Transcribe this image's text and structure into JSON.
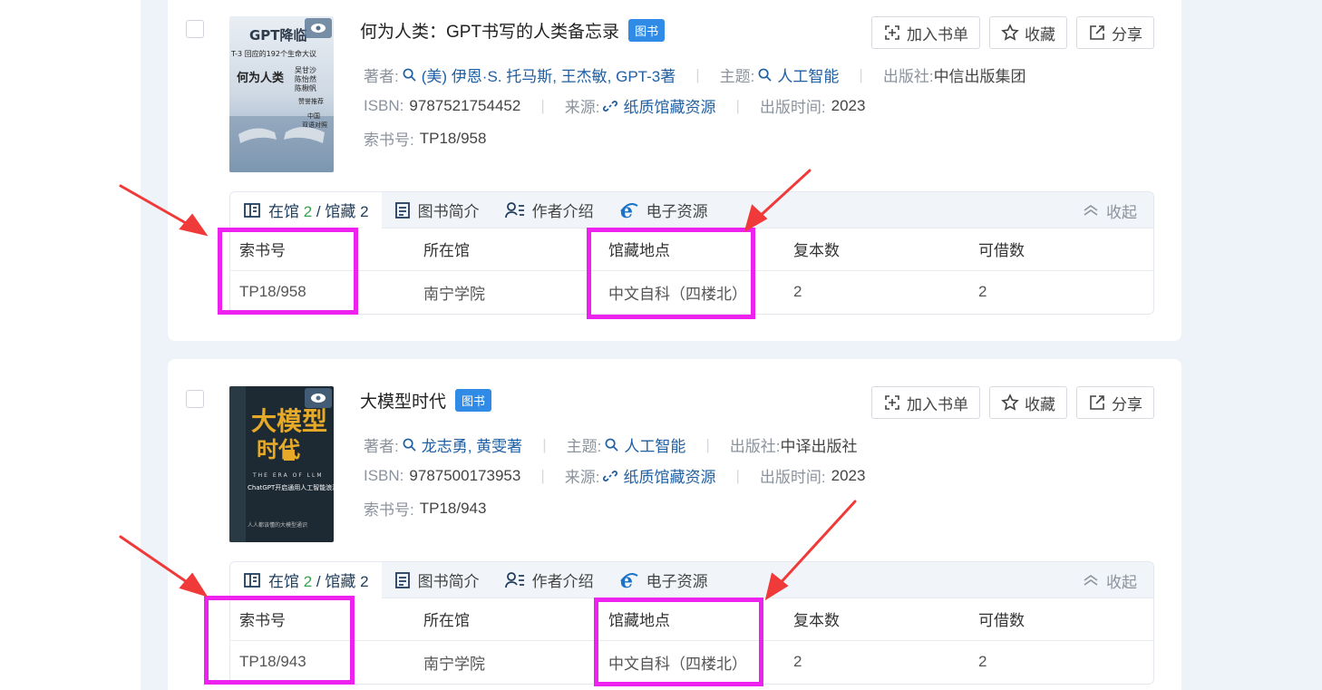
{
  "tables": {
    "headers": [
      "索书号",
      "所在馆",
      "馆藏地点",
      "复本数",
      "可借数"
    ]
  },
  "labels": {
    "author": "著者:",
    "subject": "主题:",
    "publisher": "出版社:",
    "isbn": "ISBN:",
    "source": "来源:",
    "pubyear": "出版时间:",
    "callno": "索书号:",
    "tab_avail_prefix": "在馆",
    "tab_avail_mid": " / 馆藏",
    "tab_intro": "图书简介",
    "tab_author": "作者介绍",
    "tab_eres": "电子资源",
    "collapse": "收起",
    "add_list": "加入书单",
    "favorite": "收藏",
    "share": "分享"
  },
  "colors": {
    "highlight": "#ee22ee",
    "arrow": "#f03a3a",
    "link": "#1f5fa3",
    "badge": "#2f8be6"
  },
  "books": [
    {
      "title": "何为人类：GPT书写的人类备忘录",
      "type": "图书",
      "author": "(美) 伊恩·S. 托马斯, 王杰敏, GPT-3著",
      "subject": "人工智能",
      "publisher": "中信出版集团",
      "isbn": "9787521754452",
      "source": "纸质馆藏资源",
      "pubyear": "2023",
      "callno": "TP18/958",
      "avail": "2",
      "held": "2",
      "row": [
        "TP18/958",
        "南宁学院",
        "中文自科（四楼北）",
        "2",
        "2"
      ],
      "cover_text": "GPT降临",
      "cover_sub1": "T-3 回应的192个生命大议",
      "cover_sub2": "何为人类",
      "cover_names": [
        "吴甘沙",
        "陈怡然",
        "陈楸帆"
      ],
      "cover_tag": "赞誉推荐",
      "cover_side": [
        "中国",
        "双语对照"
      ]
    },
    {
      "title": "大模型时代",
      "type": "图书",
      "author": "龙志勇, 黄雯著",
      "subject": "人工智能",
      "publisher": "中译出版社",
      "isbn": "9787500173953",
      "source": "纸质馆藏资源",
      "pubyear": "2023",
      "callno": "TP18/943",
      "avail": "2",
      "held": "2",
      "row": [
        "TP18/943",
        "南宁学院",
        "中文自科（四楼北）",
        "2",
        "2"
      ],
      "cover_text": "大模型",
      "cover_text2": "时代",
      "cover_en": "THE ERA OF LLM",
      "cover_sub1": "ChatGPT开启通用人工智能浪潮",
      "cover_sub2": "人人都该懂的大模型通识"
    }
  ]
}
